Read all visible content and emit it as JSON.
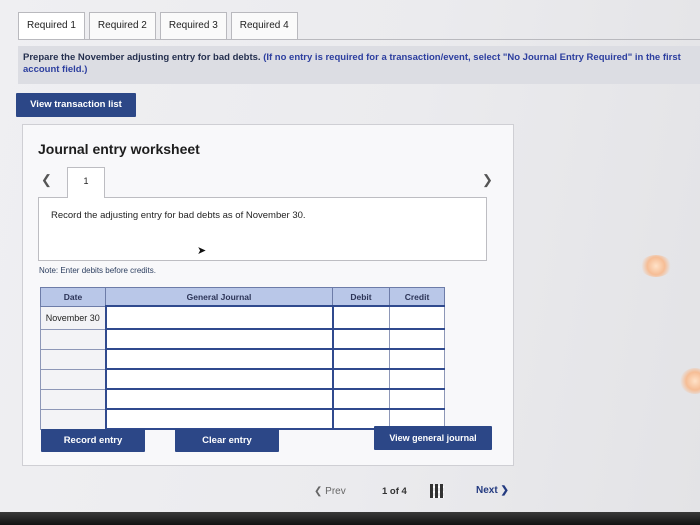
{
  "tabs": [
    "Required 1",
    "Required 2",
    "Required 3",
    "Required 4"
  ],
  "instruction": {
    "main": "Prepare the November adjusting entry for bad debts.",
    "note": "(If no entry is required for a transaction/event, select \"No Journal Entry Required\" in the first account field.)"
  },
  "view_transaction_list": "View transaction list",
  "worksheet": {
    "title": "Journal entry worksheet",
    "entry_number": "1",
    "entry_text": "Record the adjusting entry for bad debts as of November 30.",
    "note": "Note: Enter debits before credits.",
    "columns": {
      "date": "Date",
      "general_journal": "General Journal",
      "debit": "Debit",
      "credit": "Credit"
    },
    "first_date": "November 30",
    "buttons": {
      "record": "Record entry",
      "clear": "Clear entry",
      "view_journal": "View general journal"
    }
  },
  "pager": {
    "prev": "Prev",
    "page": "1 of 4",
    "next": "Next"
  },
  "colors": {
    "primary": "#2c4787",
    "header": "#b9c7e8"
  }
}
